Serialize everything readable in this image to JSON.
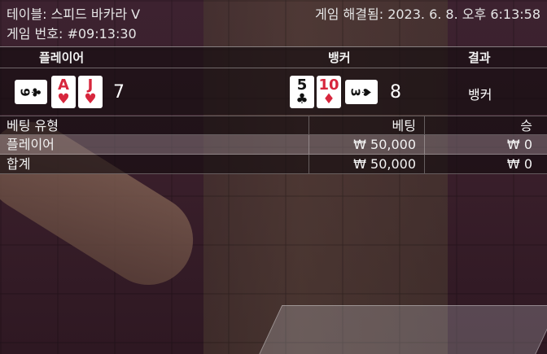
{
  "header": {
    "table_label": "테이블: 스피드 바카라 V",
    "game_number_label": "게임 번호: #09:13:30",
    "resolved_label": "게임 해결됨: 2023. 6. 8. 오후 6:13:58"
  },
  "result_table": {
    "headers": {
      "player": "플레이어",
      "banker": "뱅커",
      "result": "결과"
    },
    "player": {
      "cards": [
        {
          "rank": "9",
          "suit": "♣",
          "color": "black",
          "orientation": "sideways"
        },
        {
          "rank": "A",
          "suit": "♥",
          "color": "red",
          "orientation": "upright"
        },
        {
          "rank": "J",
          "suit": "♥",
          "color": "red",
          "orientation": "upright"
        }
      ],
      "score": "7"
    },
    "banker": {
      "cards": [
        {
          "rank": "5",
          "suit": "♣",
          "color": "black",
          "orientation": "upright"
        },
        {
          "rank": "10",
          "suit": "♦",
          "color": "red",
          "orientation": "upright"
        },
        {
          "rank": "3",
          "suit": "♠",
          "color": "black",
          "orientation": "sideways"
        }
      ],
      "score": "8"
    },
    "result": "뱅커"
  },
  "bet_table": {
    "headers": {
      "type": "베팅 유형",
      "bet": "베팅",
      "win": "승"
    },
    "rows": [
      {
        "type": "플레이어",
        "bet": "₩ 50,000",
        "win": "₩ 0"
      }
    ],
    "total": {
      "type": "합계",
      "bet": "₩ 50,000",
      "win": "₩ 0"
    }
  },
  "colors": {
    "red_suit": "#d7263d",
    "black_suit": "#111111",
    "highlight_row": "#786e73"
  }
}
